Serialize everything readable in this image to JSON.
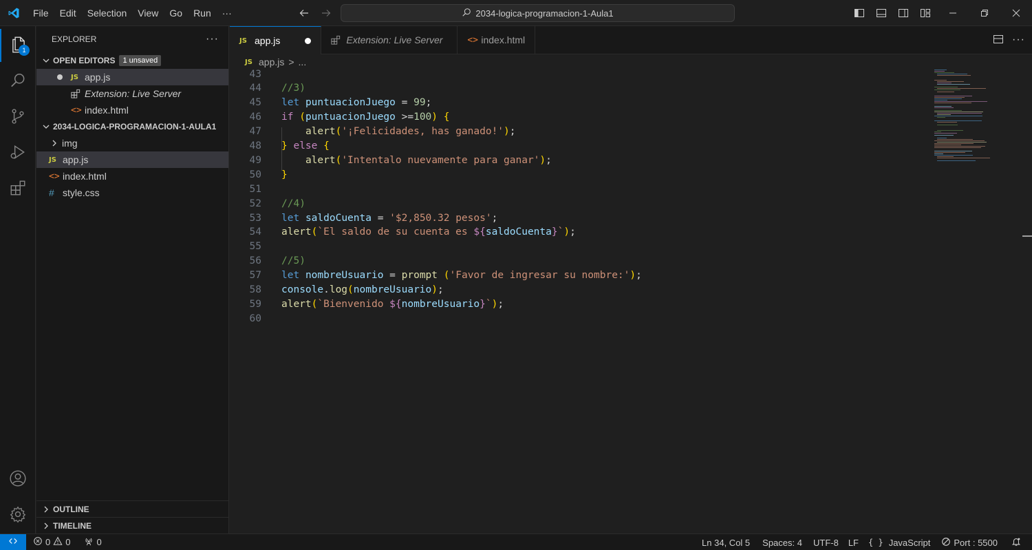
{
  "menu": [
    "File",
    "Edit",
    "Selection",
    "View",
    "Go",
    "Run",
    "···"
  ],
  "command_center": {
    "search": "2034-logica-programacion-1-Aula1"
  },
  "activity": {
    "explorer_badge": "1"
  },
  "sidebar": {
    "title": "EXPLORER",
    "more": "···",
    "open_editors": {
      "title": "OPEN EDITORS",
      "badge": "1 unsaved",
      "items": [
        {
          "icon": "JS",
          "label": "app.js"
        },
        {
          "label": "Extension: Live Server"
        },
        {
          "icon": "<>",
          "label": "index.html"
        }
      ]
    },
    "folder": {
      "title": "2034-LOGICA-PROGRAMACION-1-AULA1",
      "items": [
        {
          "label": "img"
        },
        {
          "icon": "JS",
          "label": "app.js"
        },
        {
          "icon": "<>",
          "label": "index.html"
        },
        {
          "icon": "#",
          "label": "style.css"
        }
      ]
    },
    "outline": "OUTLINE",
    "timeline": "TIMELINE"
  },
  "tabs": [
    {
      "icon": "JS",
      "label": "app.js"
    },
    {
      "label": "Extension: Live Server"
    },
    {
      "icon": "<>",
      "label": "index.html"
    }
  ],
  "breadcrumb": {
    "icon": "JS",
    "file": "app.js",
    "sep": ">",
    "rest": "..."
  },
  "editor": {
    "lines": [
      {
        "n": "43",
        "text": ""
      },
      {
        "n": "44",
        "text": "//3)"
      },
      {
        "n": "45",
        "text": "let puntuacionJuego = 99;"
      },
      {
        "n": "46",
        "text": "if (puntuacionJuego >=100) {"
      },
      {
        "n": "47",
        "text": "    alert('¡Felicidades, has ganado!');"
      },
      {
        "n": "48",
        "text": "} else {"
      },
      {
        "n": "49",
        "text": "    alert('Intentalo nuevamente para ganar');"
      },
      {
        "n": "50",
        "text": "}"
      },
      {
        "n": "51",
        "text": ""
      },
      {
        "n": "52",
        "text": "//4)"
      },
      {
        "n": "53",
        "text": "let saldoCuenta = '$2,850.32 pesos';"
      },
      {
        "n": "54",
        "text": "alert(`El saldo de su cuenta es ${saldoCuenta}`);"
      },
      {
        "n": "55",
        "text": ""
      },
      {
        "n": "56",
        "text": "//5)"
      },
      {
        "n": "57",
        "text": "let nombreUsuario = prompt ('Favor de ingresar su nombre:');"
      },
      {
        "n": "58",
        "text": "console.log(nombreUsuario);"
      },
      {
        "n": "59",
        "text": "alert(`Bienvenido ${nombreUsuario}`);"
      },
      {
        "n": "60",
        "text": ""
      }
    ]
  },
  "status": {
    "errors": "0",
    "warnings": "0",
    "ports": "0",
    "position": "Ln 34, Col 5",
    "spaces": "Spaces: 4",
    "encoding": "UTF-8",
    "eol": "LF",
    "language_icon": "{ }",
    "language": "JavaScript",
    "port": "Port : 5500"
  },
  "colors": {
    "accent": "#0078d4",
    "background": "#1f1f1f",
    "sidebar": "#181818"
  }
}
